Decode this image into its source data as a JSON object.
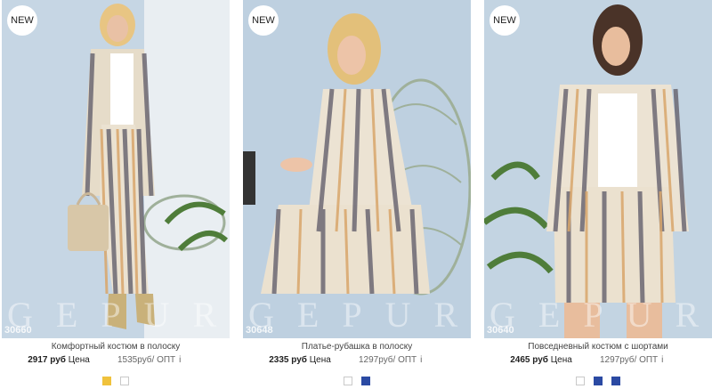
{
  "products": [
    {
      "badge": "NEW",
      "sku": "30660",
      "name": "Комфортный костюм в полоску",
      "price": "2917 руб",
      "price_label": "Цена",
      "opt_price": "1535руб/ ОПТ",
      "info": "i",
      "swatches": [
        "#f0c23c",
        "#ffffff"
      ]
    },
    {
      "badge": "NEW",
      "sku": "30648",
      "name": "Платье-рубашка в полоску",
      "price": "2335 руб",
      "price_label": "Цена",
      "opt_price": "1297руб/ ОПТ",
      "info": "i",
      "swatches": [
        "#ffffff",
        "#2b4aa3"
      ]
    },
    {
      "badge": "NEW",
      "sku": "30640",
      "name": "Повседневный костюм с шортами",
      "price": "2465 руб",
      "price_label": "Цена",
      "opt_price": "1297руб/ ОПТ",
      "info": "i",
      "swatches": [
        "#ffffff",
        "#2b4aa3",
        "#2b4aa3"
      ]
    }
  ],
  "watermark": "GEPURG"
}
